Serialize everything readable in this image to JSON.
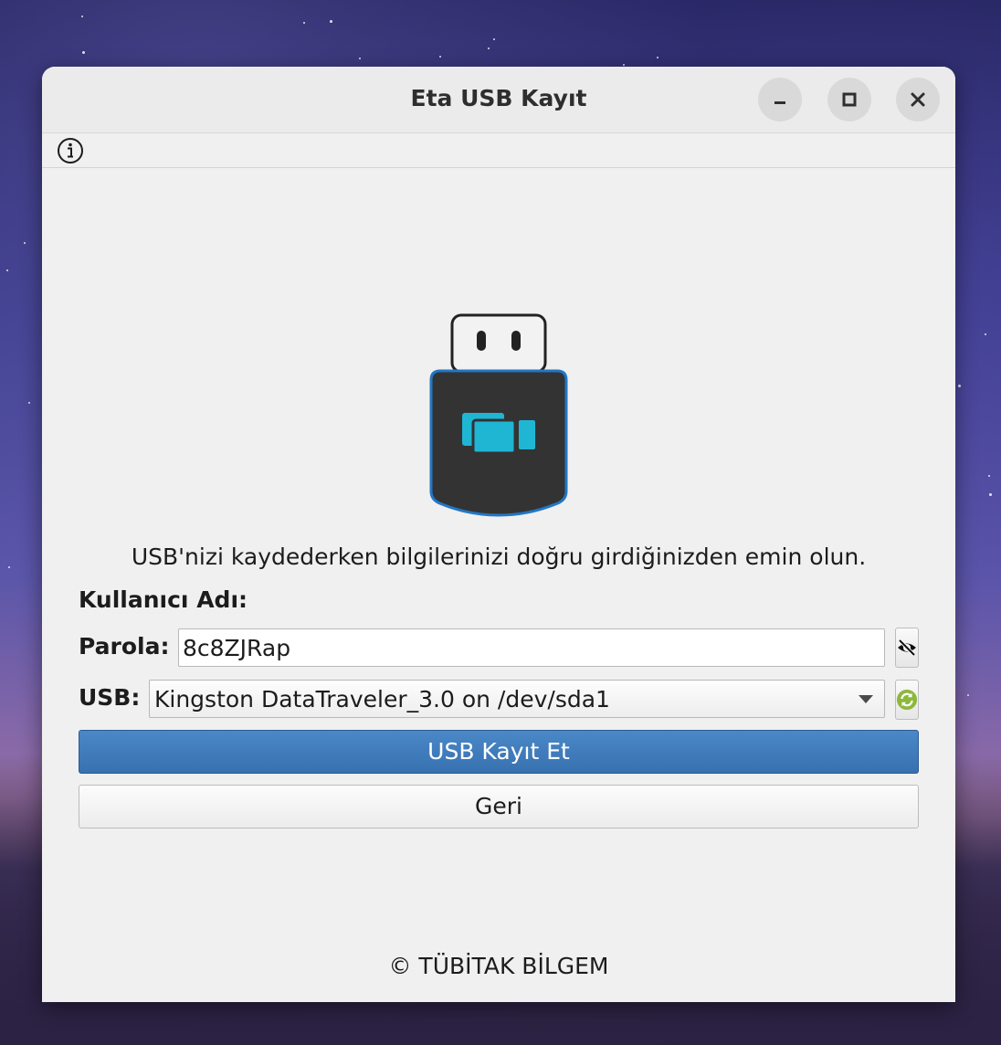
{
  "window": {
    "title": "Eta USB Kayıt"
  },
  "icons": {
    "info": "info-circle-icon",
    "minimize": "minimize-icon",
    "maximize": "maximize-icon",
    "close": "close-icon",
    "usb_illustration": "usb-drive-icon",
    "password_visibility": "eye-slash-icon",
    "refresh": "refresh-icon"
  },
  "main": {
    "info_text": "USB'nizi kaydederken bilgilerinizi doğru girdiğinizden emin olun.",
    "username_label": "Kullanıcı Adı:",
    "password_label": "Parola:",
    "password_value": "8c8ZJRap",
    "usb_label": "USB:",
    "usb_selected": "Kingston DataTraveler_3.0 on /dev/sda1",
    "register_button": "USB Kayıt Et",
    "back_button": "Geri"
  },
  "footer": {
    "text": "© TÜBİTAK BİLGEM"
  },
  "colors": {
    "primary_button": "#3d7bbb",
    "usb_accent": "#1fb6d3",
    "usb_body": "#333333",
    "refresh_icon": "#8db83b"
  }
}
